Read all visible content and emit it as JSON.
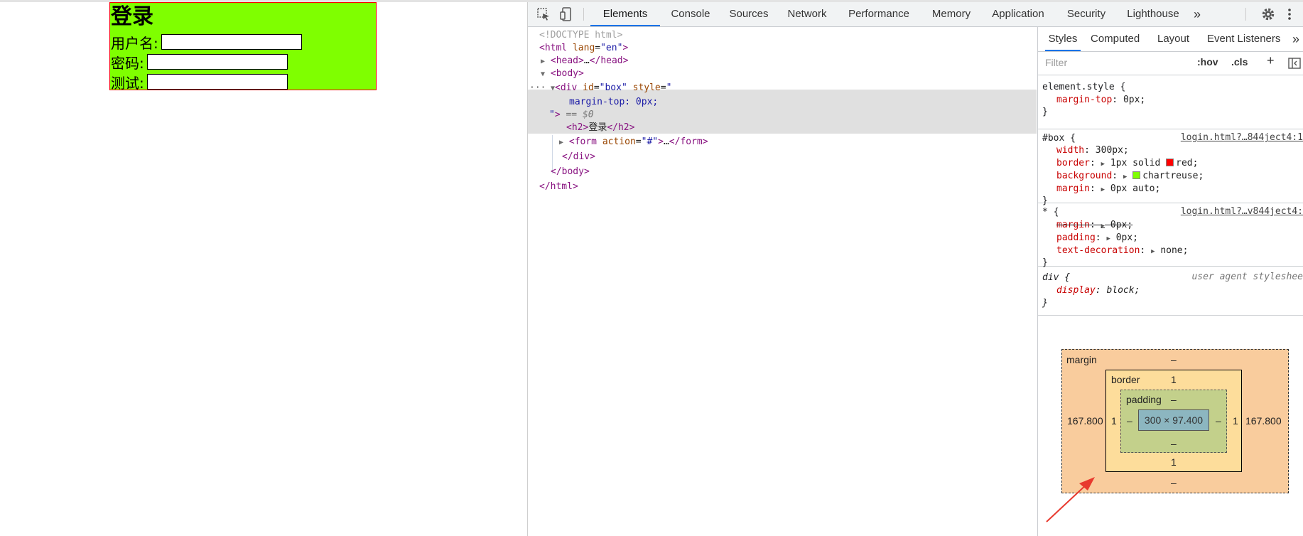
{
  "page": {
    "heading": "登录",
    "fields": [
      {
        "label": "用户名:"
      },
      {
        "label": "密码:"
      },
      {
        "label": "测试:"
      }
    ]
  },
  "devtools": {
    "tabs": [
      "Elements",
      "Console",
      "Sources",
      "Network",
      "Performance",
      "Memory",
      "Application",
      "Security",
      "Lighthouse"
    ],
    "more": "»",
    "dom": {
      "doctype": "<!DOCTYPE html>",
      "html_open_tag": "html",
      "lang_attr": "lang",
      "lang_val": "\"en\"",
      "head": "head",
      "head_ellipsis": "…",
      "body": "body",
      "div_tag": "div",
      "id_attr": "id",
      "id_val": "\"box\"",
      "style_attr": "style",
      "style_quote": "\"",
      "style_text": "margin-top: 0px;",
      "eq_dollar": "== $0",
      "h2_tag": "h2",
      "h2_text": "登录",
      "form_tag": "form",
      "action_attr": "action",
      "action_val": "\"#\"",
      "ellipsis": "…",
      "dots": "···"
    },
    "subtabs": [
      "Styles",
      "Computed",
      "Layout",
      "Event Listeners"
    ],
    "subtabs_more": "»",
    "filter_placeholder": "Filter",
    "hov": ":hov",
    "cls": ".cls",
    "plus": "+",
    "rules": {
      "element_style": {
        "selector": "element.style {",
        "props": [
          {
            "name": "margin-top",
            "value": "0px;"
          }
        ],
        "close": "}"
      },
      "box": {
        "selector": "#box {",
        "source": "login.html?…844ject4:1",
        "props": [
          {
            "name": "width",
            "value": "300px;"
          },
          {
            "name": "border",
            "value": "1px solid ",
            "swatch_color": "#ff0000",
            "value2": "red;"
          },
          {
            "name": "background",
            "value": "",
            "swatch_color": "#7fff00",
            "value2": "chartreuse;"
          },
          {
            "name": "margin",
            "value": "0px auto;"
          }
        ],
        "close": "}"
      },
      "star": {
        "selector": "* {",
        "source": "login.html?…v844ject4:",
        "props": [
          {
            "name": "margin",
            "value": "0px;"
          },
          {
            "name": "padding",
            "value": "0px;"
          },
          {
            "name": "text-decoration",
            "value": "none;"
          }
        ],
        "close": "}"
      },
      "div": {
        "selector": "div {",
        "source": "user agent styleshee",
        "props": [
          {
            "name": "display",
            "value": "block;"
          }
        ],
        "close": "}"
      }
    },
    "box_model": {
      "margin_label": "margin",
      "margin_top": "–",
      "margin_bottom": "–",
      "margin_left": "167.800",
      "margin_right": "167.800",
      "border_label": "border",
      "border_top": "1",
      "border_bottom": "1",
      "border_left": "1",
      "border_right": "1",
      "padding_label": "padding",
      "padding_top": "–",
      "padding_bottom": "–",
      "padding_left": "–",
      "padding_right": "–",
      "content": "300 × 97.400"
    }
  }
}
